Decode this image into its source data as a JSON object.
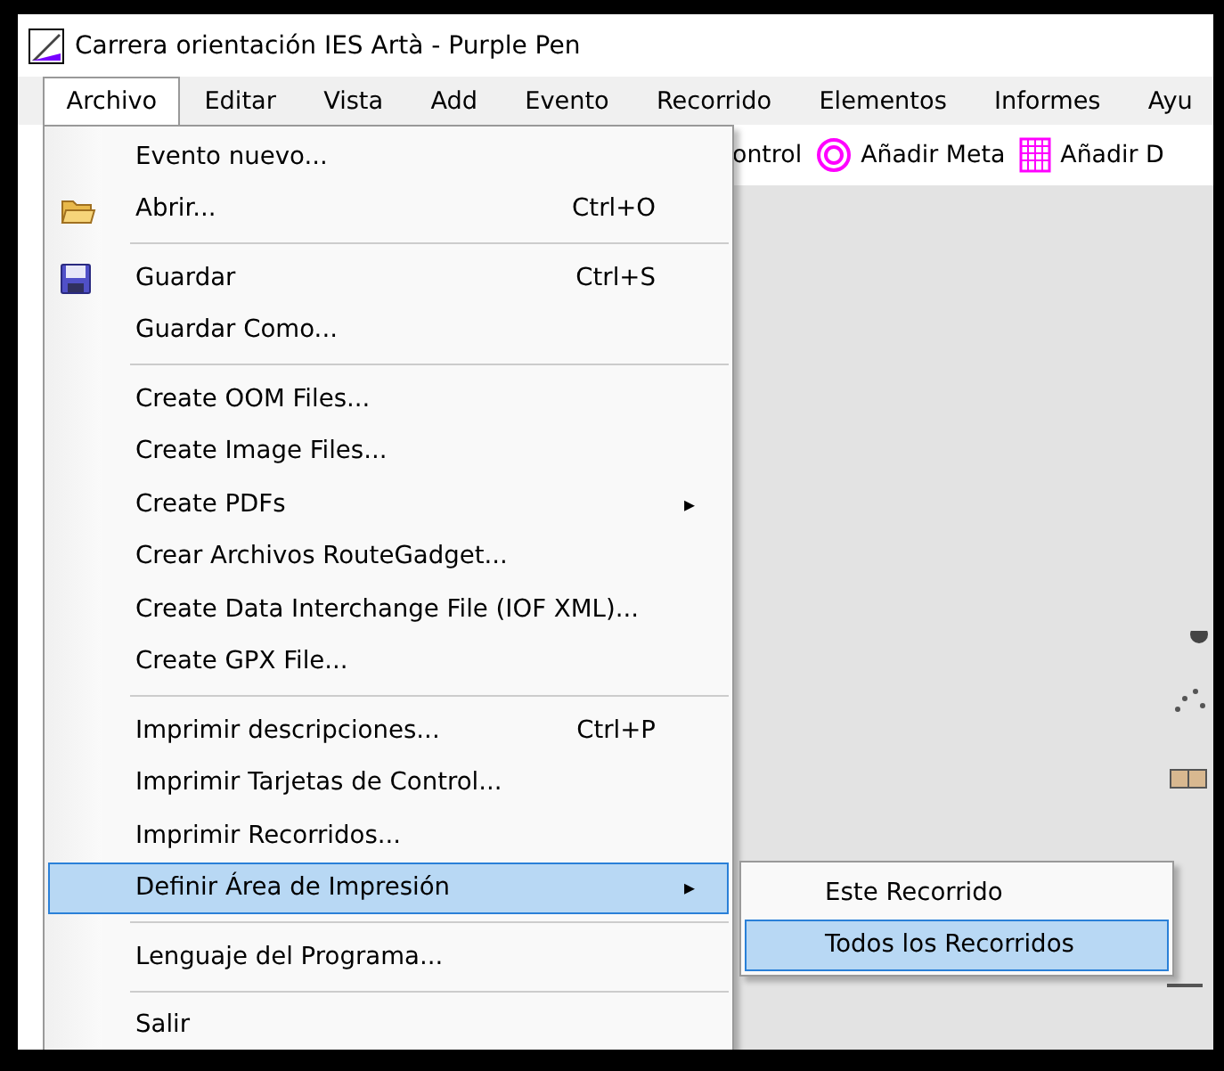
{
  "window": {
    "title": "Carrera orientación IES Artà - Purple Pen"
  },
  "menubar": [
    {
      "label": "Archivo",
      "selected": true
    },
    {
      "label": "Editar",
      "selected": false
    },
    {
      "label": "Vista",
      "selected": false
    },
    {
      "label": "Add",
      "selected": false
    },
    {
      "label": "Evento",
      "selected": false
    },
    {
      "label": "Recorrido",
      "selected": false
    },
    {
      "label": "Elementos",
      "selected": false
    },
    {
      "label": "Informes",
      "selected": false
    },
    {
      "label": "Ayu",
      "selected": false
    }
  ],
  "toolbar": [
    {
      "label": "ontrol"
    },
    {
      "label": "Añadir Meta"
    },
    {
      "label": "Añadir D"
    }
  ],
  "menu": [
    {
      "kind": "item",
      "label": "Evento nuevo...",
      "selected": false
    },
    {
      "kind": "item",
      "label": "Abrir...",
      "shortcut": "Ctrl+O",
      "selected": false
    },
    {
      "kind": "separator"
    },
    {
      "kind": "item",
      "label": "Guardar",
      "shortcut": "Ctrl+S",
      "selected": false
    },
    {
      "kind": "item",
      "label": "Guardar Como...",
      "selected": false
    },
    {
      "kind": "separator"
    },
    {
      "kind": "item",
      "label": "Create OOM Files...",
      "selected": false
    },
    {
      "kind": "item",
      "label": "Create Image Files...",
      "selected": false
    },
    {
      "kind": "submenu",
      "label": "Create PDFs",
      "arrow": "▸",
      "selected": false
    },
    {
      "kind": "item",
      "label": "Crear Archivos RouteGadget...",
      "selected": false
    },
    {
      "kind": "item",
      "label": "Create Data Interchange File (IOF XML)...",
      "selected": false
    },
    {
      "kind": "item",
      "label": "Create GPX File...",
      "selected": false
    },
    {
      "kind": "separator"
    },
    {
      "kind": "item",
      "label": "Imprimir descripciones...",
      "shortcut": "Ctrl+P",
      "selected": false
    },
    {
      "kind": "item",
      "label": "Imprimir Tarjetas de Control...",
      "selected": false
    },
    {
      "kind": "item",
      "label": "Imprimir Recorridos...",
      "selected": false
    },
    {
      "kind": "submenu",
      "label": "Definir Área de Impresión",
      "arrow": "▸",
      "selected": true
    },
    {
      "kind": "separator"
    },
    {
      "kind": "item",
      "label": "Lenguaje del Programa...",
      "selected": false
    },
    {
      "kind": "separator"
    },
    {
      "kind": "item",
      "label": "Salir",
      "selected": false
    }
  ],
  "submenu": [
    {
      "label": "Este Recorrido",
      "selected": false
    },
    {
      "label": "Todos los Recorridos",
      "selected": true
    }
  ]
}
